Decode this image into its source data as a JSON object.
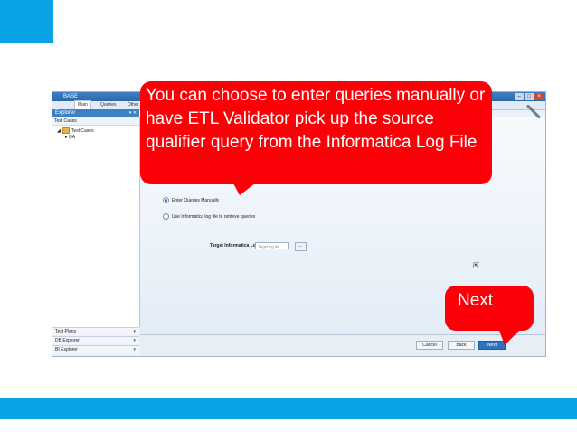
{
  "titlebar": {
    "text": "BASE"
  },
  "ribbon": {
    "tabs": [
      {
        "label": "Main"
      },
      {
        "label": "Queries"
      },
      {
        "label": "Other"
      }
    ]
  },
  "explorer": {
    "title": "Explorer",
    "section": "Test Cases",
    "tree": [
      {
        "label": "Test Cases"
      },
      {
        "label": "QA"
      }
    ]
  },
  "bottom_panels": [
    {
      "label": "Test Plans"
    },
    {
      "label": "DB Explorer"
    },
    {
      "label": "BI Explorer"
    }
  ],
  "wizard": {
    "option_manual": "Enter Queries Manually",
    "option_log": "Use Informatica log file to retrieve queries",
    "target_label": "Target Informatica Log :",
    "target_placeholder": "Target log file",
    "browse": "..."
  },
  "footer": {
    "cancel": "Cancel",
    "back": "Back",
    "next": "Next"
  },
  "callouts": {
    "main": "You can choose to enter queries manually or have ETL Validator pick up the source qualifier query from the Informatica Log File",
    "next": "Next"
  },
  "colors": {
    "accent_blue": "#0aa3e6",
    "callout_red": "#fb0006"
  }
}
